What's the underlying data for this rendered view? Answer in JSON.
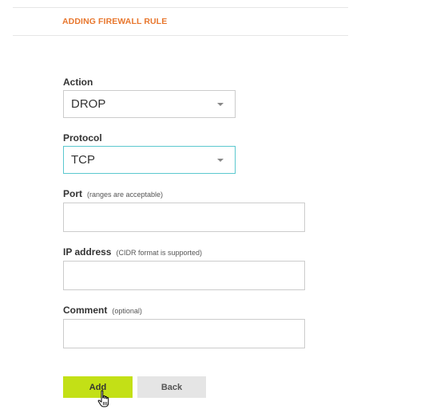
{
  "header": {
    "title": "ADDING FIREWALL RULE"
  },
  "form": {
    "action": {
      "label": "Action",
      "value": "DROP"
    },
    "protocol": {
      "label": "Protocol",
      "value": "TCP"
    },
    "port": {
      "label": "Port",
      "hint": "(ranges are acceptable)",
      "value": "",
      "placeholder": ""
    },
    "ip_address": {
      "label": "IP address",
      "hint": "(CIDR format is supported)",
      "value": "",
      "placeholder": ""
    },
    "comment": {
      "label": "Comment",
      "hint": "(optional)",
      "value": "",
      "placeholder": ""
    }
  },
  "buttons": {
    "add_label": "Add",
    "back_label": "Back"
  },
  "cursor": {
    "icon": "hand-pointer-icon"
  },
  "colors": {
    "title": "#e8772e",
    "add_button": "#c3e016",
    "back_button": "#e5e5e5",
    "focus_border": "#5bc8cf",
    "input_border": "#cccccc",
    "rule": "#e6e6e6"
  }
}
